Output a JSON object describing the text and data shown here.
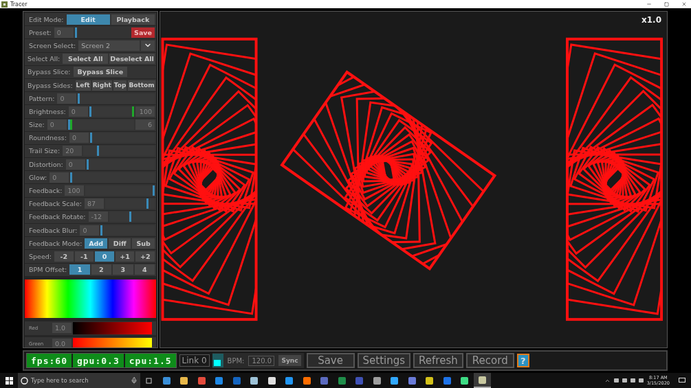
{
  "title_bar": {
    "title": "Tracer"
  },
  "panel": {
    "rows": [
      {
        "kind": "segmented",
        "label": "Edit Mode:",
        "options": [
          {
            "label": "Edit",
            "selected": true
          },
          {
            "label": "Playback",
            "selected": false
          }
        ]
      },
      {
        "kind": "preset",
        "label": "Preset:",
        "value": "0",
        "action": "Save"
      },
      {
        "kind": "select",
        "label": "Screen Select:",
        "value": "Screen 2"
      },
      {
        "kind": "buttons",
        "label": "Select All:",
        "buttons": [
          "Select All",
          "Deselect All"
        ]
      },
      {
        "kind": "buttons",
        "label": "Bypass Slice:",
        "buttons": [
          "Bypass Slice"
        ]
      },
      {
        "kind": "buttons",
        "label": "Bypass Sides:",
        "buttons": [
          "Left",
          "Right",
          "Top",
          "Bottom"
        ]
      },
      {
        "kind": "slider",
        "label": "Pattern:",
        "value": "0",
        "level": 0
      },
      {
        "kind": "range",
        "label": "Brightness:",
        "min_value": "0",
        "max_value": "100",
        "thumbs": [
          {
            "level": 0
          },
          {
            "level": 1
          }
        ]
      },
      {
        "kind": "range",
        "label": "Size:",
        "min_value": "0",
        "max_value": "6",
        "thumbs": [
          {
            "level": 0
          },
          {
            "level": 0.03
          }
        ]
      },
      {
        "kind": "slider",
        "label": "Roundness:",
        "value": "0",
        "level": 0
      },
      {
        "kind": "slider",
        "label": "Trail Size:",
        "value": "20",
        "level": 0.2
      },
      {
        "kind": "slider",
        "label": "Distortion:",
        "value": "0",
        "level": 0
      },
      {
        "kind": "slider",
        "label": "Glow:",
        "value": "0",
        "level": 0
      },
      {
        "kind": "slider",
        "label": "Feedback:",
        "value": "100",
        "level": 1
      },
      {
        "kind": "slider",
        "label": "Feedback Scale:",
        "value": "87",
        "level": 0.87
      },
      {
        "kind": "slider",
        "label": "Feedback Rotate:",
        "value": "-12",
        "level": 0.47
      },
      {
        "kind": "slider",
        "label": "Feedback Blur:",
        "value": "0",
        "level": 0
      },
      {
        "kind": "segmented",
        "label": "Feedback Mode:",
        "options": [
          {
            "label": "Add",
            "selected": true
          },
          {
            "label": "Diff",
            "selected": false
          },
          {
            "label": "Sub",
            "selected": false
          }
        ]
      },
      {
        "kind": "segmented",
        "label": "Speed:",
        "options": [
          {
            "label": "-2",
            "selected": false
          },
          {
            "label": "-1",
            "selected": false
          },
          {
            "label": "0",
            "selected": true
          },
          {
            "label": "+1",
            "selected": false
          },
          {
            "label": "+2",
            "selected": false
          }
        ]
      },
      {
        "kind": "segmented",
        "label": "BPM Offset:",
        "options": [
          {
            "label": "1",
            "selected": true
          },
          {
            "label": "2",
            "selected": false
          },
          {
            "label": "3",
            "selected": false
          },
          {
            "label": "4",
            "selected": false
          }
        ]
      }
    ],
    "channels": [
      {
        "kind": "red",
        "name": "Red",
        "value": "1.0"
      },
      {
        "kind": "green",
        "name": "Green",
        "value": "0.0"
      }
    ]
  },
  "canvas": {
    "zoom": "x1.0"
  },
  "bottom_bar": {
    "stats": [
      "fps:60",
      "gpu:0.3",
      "cpu:1.5"
    ],
    "link": "Link 0",
    "swatch": {
      "color": "#00ffff"
    },
    "bpm_label": "BPM:",
    "bpm": "120.0",
    "sync": "Sync",
    "buttons": [
      "Save",
      "Settings",
      "Refresh",
      "Record"
    ],
    "help": "?"
  },
  "taskbar": {
    "search_placeholder": "Type here to search",
    "apps": [
      {
        "color": "#3a8fd8",
        "selected": false
      },
      {
        "color": "#e8b84a",
        "selected": false
      },
      {
        "color": "#e44b3c",
        "selected": false
      },
      {
        "color": "#1e88e5",
        "selected": false
      },
      {
        "color": "#1565c0",
        "selected": false
      },
      {
        "color": "#9ec3d8",
        "selected": false
      },
      {
        "color": "#e0e0e0",
        "selected": false
      },
      {
        "color": "#2196f3",
        "selected": false
      },
      {
        "color": "#ff6d00",
        "selected": false
      },
      {
        "color": "#5c6bc0",
        "selected": false
      },
      {
        "color": "#1f8e4a",
        "selected": false
      },
      {
        "color": "#3f51b5",
        "selected": false
      },
      {
        "color": "#9e9e9e",
        "selected": false
      },
      {
        "color": "#31a8ff",
        "selected": false
      },
      {
        "color": "#6a7bd8",
        "selected": false
      },
      {
        "color": "#d4c21a",
        "selected": false
      },
      {
        "color": "#1e73e8",
        "selected": false
      },
      {
        "color": "#3ddc84",
        "selected": false
      },
      {
        "color": "#c8c8a0",
        "selected": true
      }
    ],
    "time": "8:17 AM",
    "date": "3/15/2020"
  }
}
